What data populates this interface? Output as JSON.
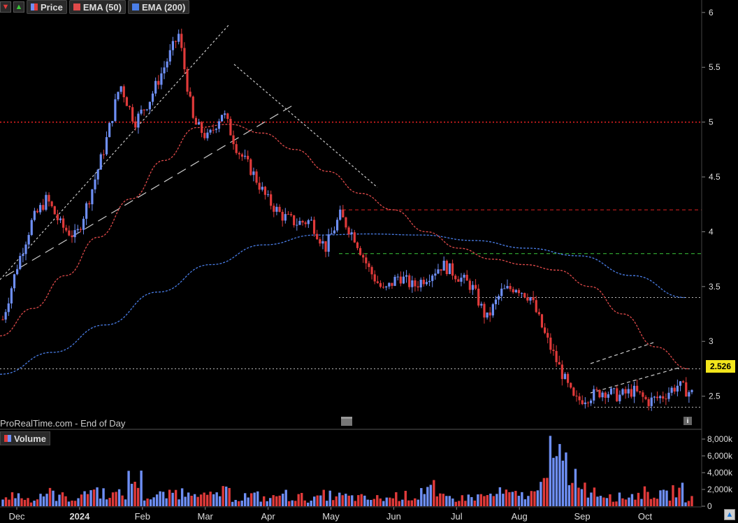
{
  "legend": {
    "price_label": "Price",
    "ema50_label": "EMA (50)",
    "ema200_label": "EMA (200)"
  },
  "watermark": "ProRealTime.com - End of Day",
  "volume_label": "Volume",
  "last_price_label": "2.526",
  "colors": {
    "background": "#000000",
    "up_candle": "#6e8ff5",
    "down_candle": "#e03a3a",
    "ema50": "#e04a4a",
    "ema200": "#4a7ee8",
    "resistance_red": "#e02020",
    "support_green": "#3ac83a",
    "last_price_tag": "#f2e51b"
  },
  "icons": [
    "arrow-down-icon",
    "arrow-up-icon",
    "calendar-icon",
    "info-icon",
    "scroll-up-icon"
  ],
  "chart_data": [
    {
      "type": "candlestick",
      "title": "",
      "series": [
        {
          "name": "Price",
          "values": [
            3.2,
            3.7,
            4.1,
            4.3,
            4.05,
            3.95,
            4.35,
            4.8,
            5.35,
            5.0,
            5.2,
            5.5,
            5.8,
            5.0,
            4.85,
            5.1,
            4.75,
            4.55,
            4.3,
            4.15,
            4.08,
            4.1,
            3.85,
            4.15,
            3.95,
            3.65,
            3.45,
            3.6,
            3.5,
            3.6,
            3.7,
            3.6,
            3.5,
            3.2,
            3.45,
            3.5,
            3.4,
            3.05,
            2.75,
            2.45,
            2.5,
            2.55,
            2.5,
            2.55,
            2.45,
            2.5,
            2.6,
            2.526
          ]
        },
        {
          "name": "EMA (50)",
          "values": [
            3.05,
            3.3,
            3.6,
            3.95,
            4.3,
            4.65,
            4.95,
            4.98,
            4.9,
            4.75,
            4.55,
            4.35,
            4.2,
            4.0,
            3.85,
            3.75,
            3.7,
            3.65,
            3.5,
            3.25,
            2.95,
            2.75
          ]
        },
        {
          "name": "EMA (200)",
          "values": [
            2.7,
            2.9,
            3.15,
            3.45,
            3.7,
            3.88,
            3.97,
            3.98,
            3.97,
            3.92,
            3.85,
            3.78,
            3.6,
            3.4
          ]
        }
      ],
      "x_tick_labels": [
        "Dec",
        "2024",
        "Feb",
        "Mar",
        "Apr",
        "May",
        "Jun",
        "Jul",
        "Aug",
        "Sep",
        "Oct"
      ],
      "y_tick_labels": [
        "6",
        "5.5",
        "5",
        "4.5",
        "4",
        "3.5",
        "3",
        "2.5"
      ],
      "ylim": [
        2.3,
        6.05
      ],
      "horizontal_levels": [
        {
          "value": 5.0,
          "color": "red",
          "style": "dotted"
        },
        {
          "value": 4.2,
          "color": "red",
          "style": "dashed"
        },
        {
          "value": 3.8,
          "color": "green",
          "style": "dashed"
        },
        {
          "value": 3.4,
          "color": "white",
          "style": "dotted"
        },
        {
          "value": 2.75,
          "color": "white",
          "style": "dotted"
        },
        {
          "value": 2.4,
          "color": "white",
          "style": "dotted"
        }
      ],
      "last_price": 2.526,
      "grid": false
    },
    {
      "type": "bar",
      "title": "Volume",
      "y_tick_labels": [
        "8,000k",
        "6,000k",
        "4,000k",
        "2,000k",
        "0"
      ],
      "ylim": [
        0,
        8500
      ],
      "values_k": [
        1400,
        1800,
        1200,
        2100,
        1600,
        1300,
        2700,
        2200,
        1900,
        4200,
        1500,
        1800,
        2300,
        3100,
        1600,
        2200,
        1400,
        1700,
        1300,
        1900,
        1500,
        1200,
        1800,
        1600,
        1400,
        1200,
        1300,
        1700,
        1600,
        2900,
        1400,
        1300,
        1500,
        1700,
        2100,
        1800,
        2000,
        7700,
        7100,
        5100,
        2800,
        2100,
        1500,
        1800,
        2200,
        1800,
        2600,
        1300
      ]
    }
  ]
}
